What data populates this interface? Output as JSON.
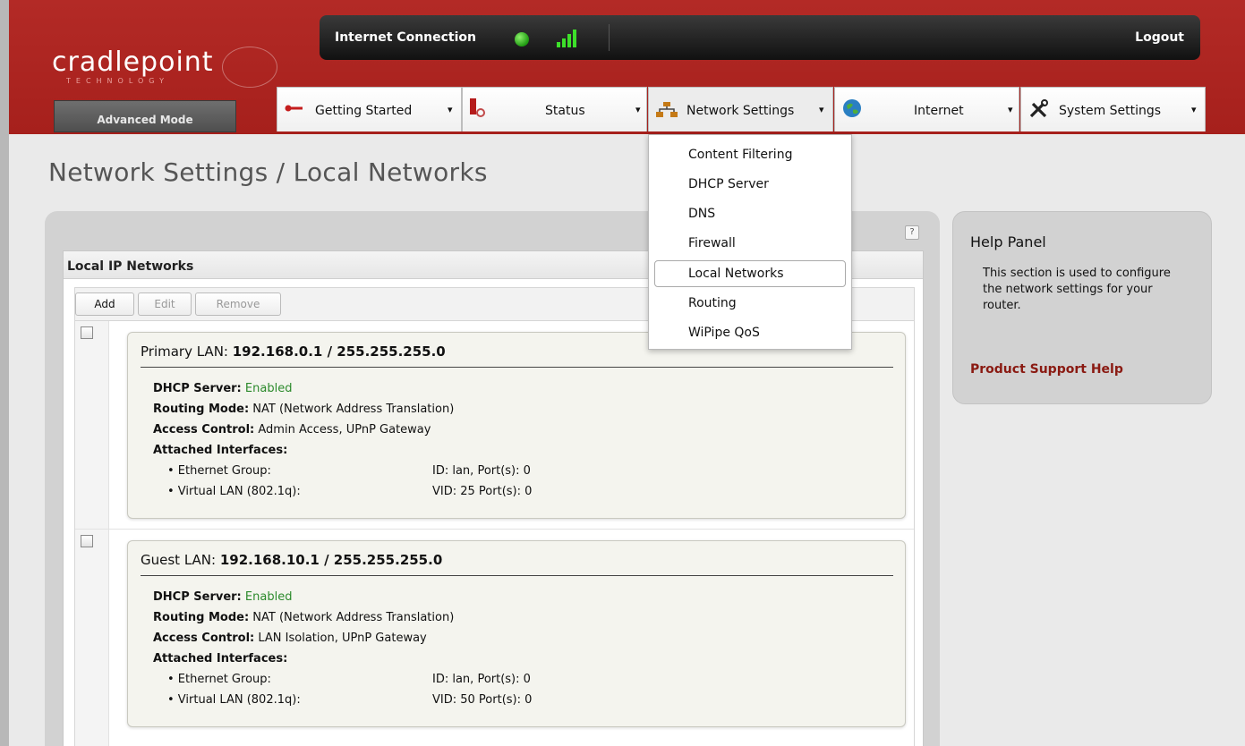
{
  "header": {
    "logo": "cradlepoint",
    "logo_sub": "TECHNOLOGY",
    "mode_label": "Advanced Mode",
    "connection_label": "Internet Connection",
    "logout_label": "Logout"
  },
  "tabs": [
    {
      "label": "Getting Started",
      "icon": "key-icon"
    },
    {
      "label": "Status",
      "icon": "status-icon"
    },
    {
      "label": "Network Settings",
      "icon": "network-icon"
    },
    {
      "label": "Internet",
      "icon": "globe-icon"
    },
    {
      "label": "System Settings",
      "icon": "tools-icon"
    }
  ],
  "arrow": "▾",
  "dropdown": {
    "items": [
      "Content Filtering",
      "DHCP Server",
      "DNS",
      "Firewall",
      "Local Networks",
      "Routing",
      "WiPipe QoS"
    ],
    "selected": "Local Networks"
  },
  "page": {
    "title": "Network Settings / Local Networks",
    "help_icon": "?"
  },
  "section": {
    "title": "Local IP Networks",
    "buttons": {
      "add": "Add",
      "edit": "Edit",
      "remove": "Remove"
    }
  },
  "labels": {
    "dhcp": "DHCP Server:",
    "routing": "Routing Mode:",
    "access": "Access Control:",
    "attached": "Attached Interfaces:"
  },
  "networks": [
    {
      "name": "Primary LAN:",
      "address": "192.168.0.1 / 255.255.255.0",
      "dhcp": "Enabled",
      "routing": "NAT (Network Address Translation)",
      "access": "Admin Access, UPnP Gateway",
      "interfaces": [
        {
          "name": "• Ethernet Group:",
          "value": "ID: lan, Port(s): 0"
        },
        {
          "name": "• Virtual LAN (802.1q):",
          "value": "VID: 25 Port(s): 0"
        }
      ]
    },
    {
      "name": "Guest LAN:",
      "address": "192.168.10.1 / 255.255.255.0",
      "dhcp": "Enabled",
      "routing": "NAT (Network Address Translation)",
      "access": "LAN Isolation, UPnP Gateway",
      "interfaces": [
        {
          "name": "• Ethernet Group:",
          "value": "ID: lan, Port(s): 0"
        },
        {
          "name": "• Virtual LAN (802.1q):",
          "value": "VID: 50 Port(s): 0"
        }
      ]
    }
  ],
  "help": {
    "title": "Help Panel",
    "text": "This section is used to configure the network settings for your router.",
    "link": "Product Support Help"
  },
  "colors": {
    "brand_red": "#a6201c",
    "enabled_green": "#2c8a2c",
    "link_red": "#8a1a12"
  }
}
